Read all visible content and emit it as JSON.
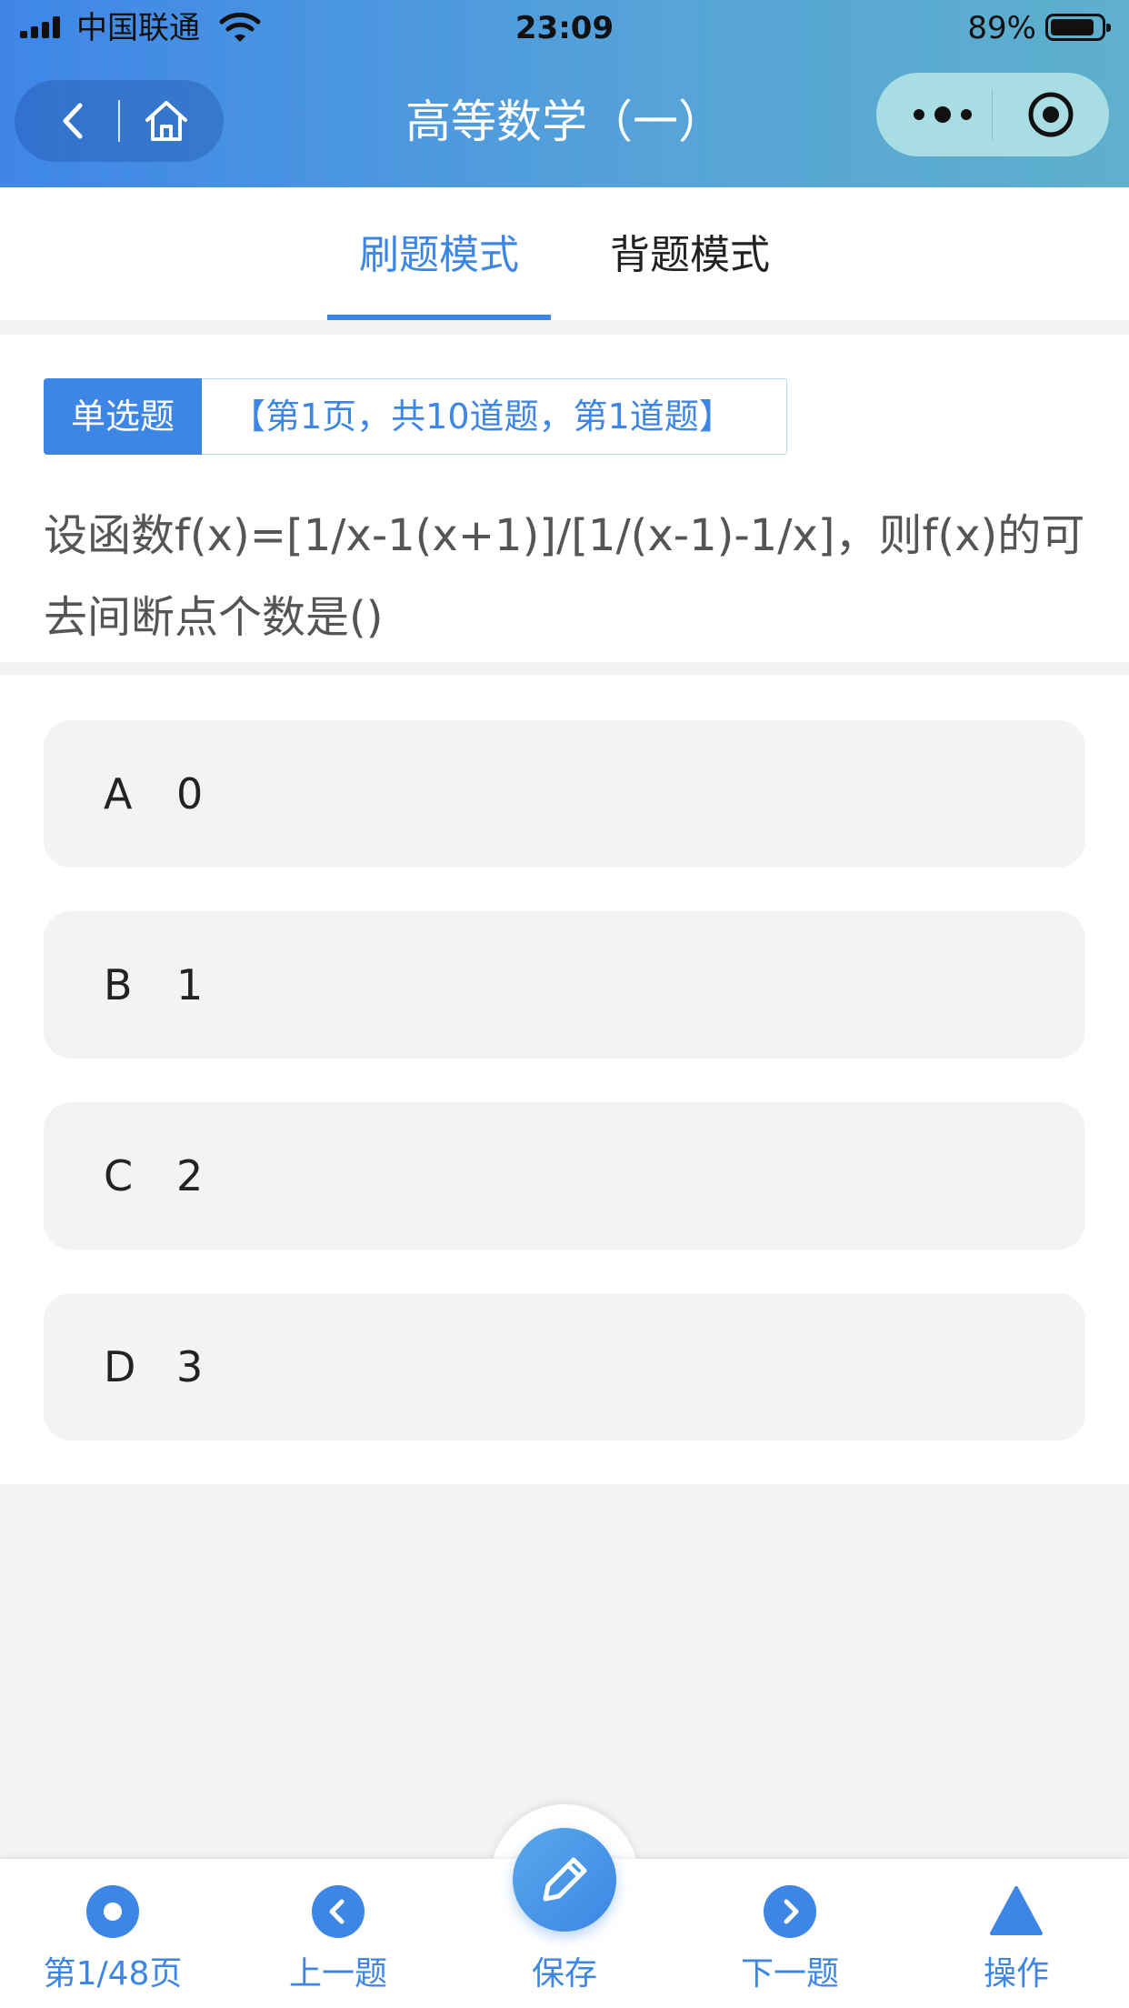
{
  "status_bar": {
    "carrier": "中国联通",
    "time": "23:09",
    "battery_text": "89%",
    "battery_level": 0.89
  },
  "nav": {
    "title": "高等数学（一）",
    "back_icon": "chevron-left-icon",
    "home_icon": "home-icon",
    "more_icon": "more-dots-icon",
    "close_icon": "target-close-icon"
  },
  "tabs": [
    {
      "label": "刷题模式",
      "active": true
    },
    {
      "label": "背题模式",
      "active": false
    }
  ],
  "question": {
    "type": "单选题",
    "info": "【第1页，共10道题，第1道题】",
    "text": "设函数f(x)=[1/x-1(x+1)]/[1/(x-1)-1/x]，则f(x)的可去间断点个数是()"
  },
  "options": [
    {
      "letter": "A",
      "text": "0"
    },
    {
      "letter": "B",
      "text": "1"
    },
    {
      "letter": "C",
      "text": "2"
    },
    {
      "letter": "D",
      "text": "3"
    }
  ],
  "bottom_bar": {
    "page": "第1/48页",
    "prev": "上一题",
    "save": "保存",
    "next": "下一题",
    "operate": "操作"
  },
  "colors": {
    "accent": "#3d86e5",
    "header_start": "#3f86e8",
    "header_end": "#5eb0cc"
  }
}
